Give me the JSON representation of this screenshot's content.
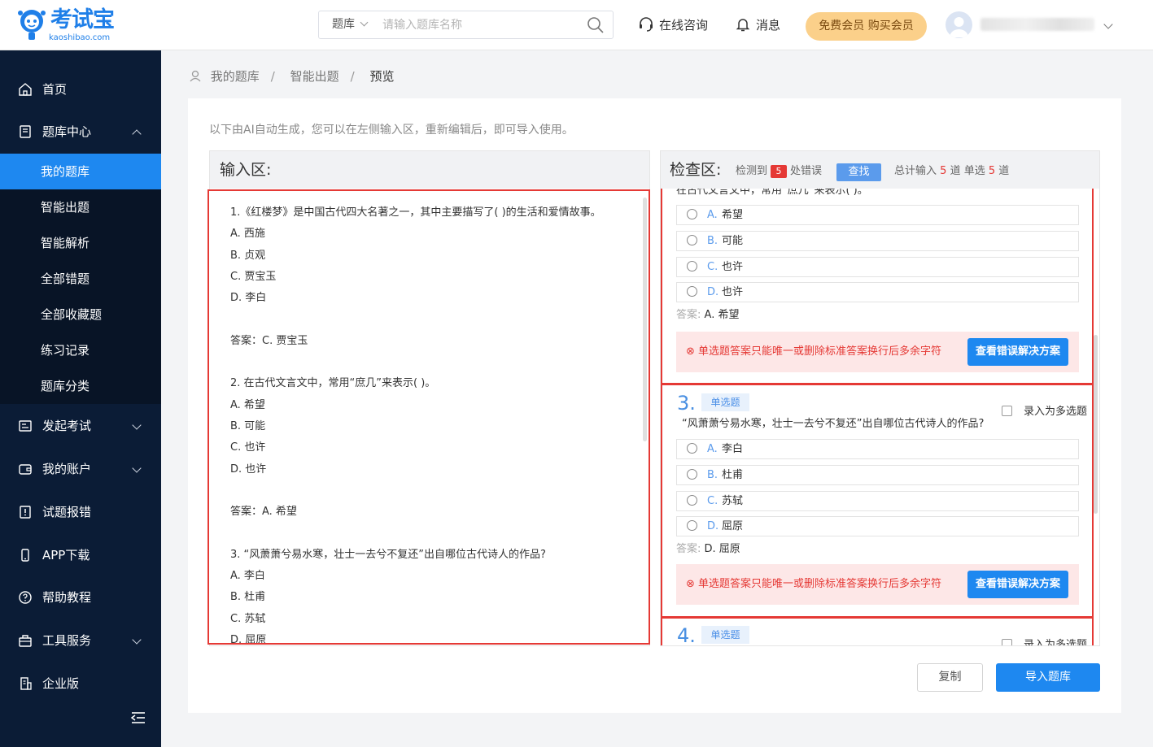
{
  "header": {
    "logo_brand": "考试宝",
    "logo_domain": "kaoshibao.com",
    "search_scope": "题库",
    "search_placeholder": "请输入题库名称",
    "consult": "在线咨询",
    "messages": "消息",
    "vip": "免费会员 购买会员"
  },
  "sidebar": {
    "home": "首页",
    "bank_center": "题库中心",
    "sub": [
      "我的题库",
      "智能出题",
      "智能解析",
      "全部错题",
      "全部收藏题",
      "练习记录",
      "题库分类"
    ],
    "exam": "发起考试",
    "account": "我的账户",
    "report": "试题报错",
    "app": "APP下载",
    "help": "帮助教程",
    "tools": "工具服务",
    "enterprise": "企业版"
  },
  "breadcrumb": [
    "我的题库",
    "智能出题",
    "预览"
  ],
  "hint": "以下由AI自动生成，您可以在左侧输入区，重新编辑后，即可导入使用。",
  "input_pane": {
    "title": "输入区:",
    "lines": [
      "1.《红楼梦》是中国古代四大名著之一，其中主要描写了( )的生活和爱情故事。",
      "A. 西施",
      "B. 贞观",
      "C. 贾宝玉",
      "D. 李白",
      "",
      "答案：C. 贾宝玉",
      "",
      "2. 在古代文言文中，常用“庶几”来表示( )。",
      "A. 希望",
      "B. 可能",
      "C. 也许",
      "D. 也许",
      "",
      "答案：A. 希望",
      "",
      "3. “风萧萧兮易水寒，壮士一去兮不复还”出自哪位古代诗人的作品?",
      "A. 李白",
      "B. 杜甫",
      "C. 苏轼",
      "D. 屈原"
    ]
  },
  "check_pane": {
    "title": "检查区:",
    "detected_prefix": "检测到",
    "error_count": "5",
    "detected_suffix": "处错误",
    "find": "查找",
    "total_prefix": "总计输入",
    "total_count": "5",
    "total_mid": "道 单选",
    "single_count": "5",
    "total_suffix": "道",
    "multi_label": "录入为多选题",
    "answer_key": "答案:",
    "error_msg": "单选题答案只能唯一或删除标准答案换行后多余字符",
    "solution_btn": "查看错误解决方案",
    "q2": {
      "text_partial": "在古代文言文中，常用“庶几”来表示( )。",
      "options": [
        {
          "l": "A.",
          "t": "希望"
        },
        {
          "l": "B.",
          "t": "可能"
        },
        {
          "l": "C.",
          "t": "也许"
        },
        {
          "l": "D.",
          "t": "也许"
        }
      ],
      "answer": "A. 希望"
    },
    "q3": {
      "num": "3.",
      "type": "单选题",
      "text": "“风萧萧兮易水寒，壮士一去兮不复还”出自哪位古代诗人的作品?",
      "options": [
        {
          "l": "A.",
          "t": "李白"
        },
        {
          "l": "B.",
          "t": "杜甫"
        },
        {
          "l": "C.",
          "t": "苏轼"
        },
        {
          "l": "D.",
          "t": "屈原"
        }
      ],
      "answer": "D. 屈原"
    },
    "q4": {
      "num": "4.",
      "type": "单选题"
    }
  },
  "actions": {
    "copy": "复制",
    "import": "导入题库"
  }
}
